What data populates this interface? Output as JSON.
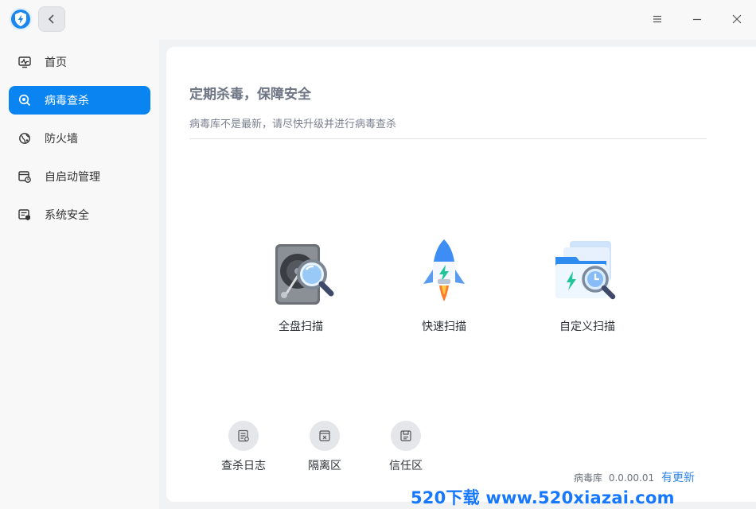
{
  "window": {
    "menu_icon": "hamburger-icon",
    "minimize_icon": "minimize-icon",
    "close_icon": "close-icon"
  },
  "sidebar": {
    "items": [
      {
        "label": "首页",
        "icon": "pulse-monitor-icon",
        "active": false
      },
      {
        "label": "病毒查杀",
        "icon": "virus-scan-icon",
        "active": true
      },
      {
        "label": "防火墙",
        "icon": "firewall-globe-icon",
        "active": false
      },
      {
        "label": "自启动管理",
        "icon": "startup-manager-icon",
        "active": false
      },
      {
        "label": "系统安全",
        "icon": "system-security-icon",
        "active": false
      }
    ]
  },
  "main": {
    "headline": "定期杀毒，保障安全",
    "subline": "病毒库不是最新，请尽快升级并进行病毒查杀",
    "scan_options": [
      {
        "label": "全盘扫描",
        "icon": "hard-disk-magnifier-icon"
      },
      {
        "label": "快速扫描",
        "icon": "rocket-icon"
      },
      {
        "label": "自定义扫描",
        "icon": "folder-magnifier-icon"
      }
    ],
    "tools": [
      {
        "label": "查杀日志",
        "icon": "log-icon"
      },
      {
        "label": "隔离区",
        "icon": "quarantine-icon"
      },
      {
        "label": "信任区",
        "icon": "trust-icon"
      }
    ],
    "db_label": "病毒库",
    "db_version": "0.0.00.01",
    "update_link": "有更新"
  },
  "watermark": "520下载 www.520xiazai.com",
  "colors": {
    "accent": "#0a84f0",
    "link": "#2f86e8",
    "watermark": "#1677ff"
  }
}
